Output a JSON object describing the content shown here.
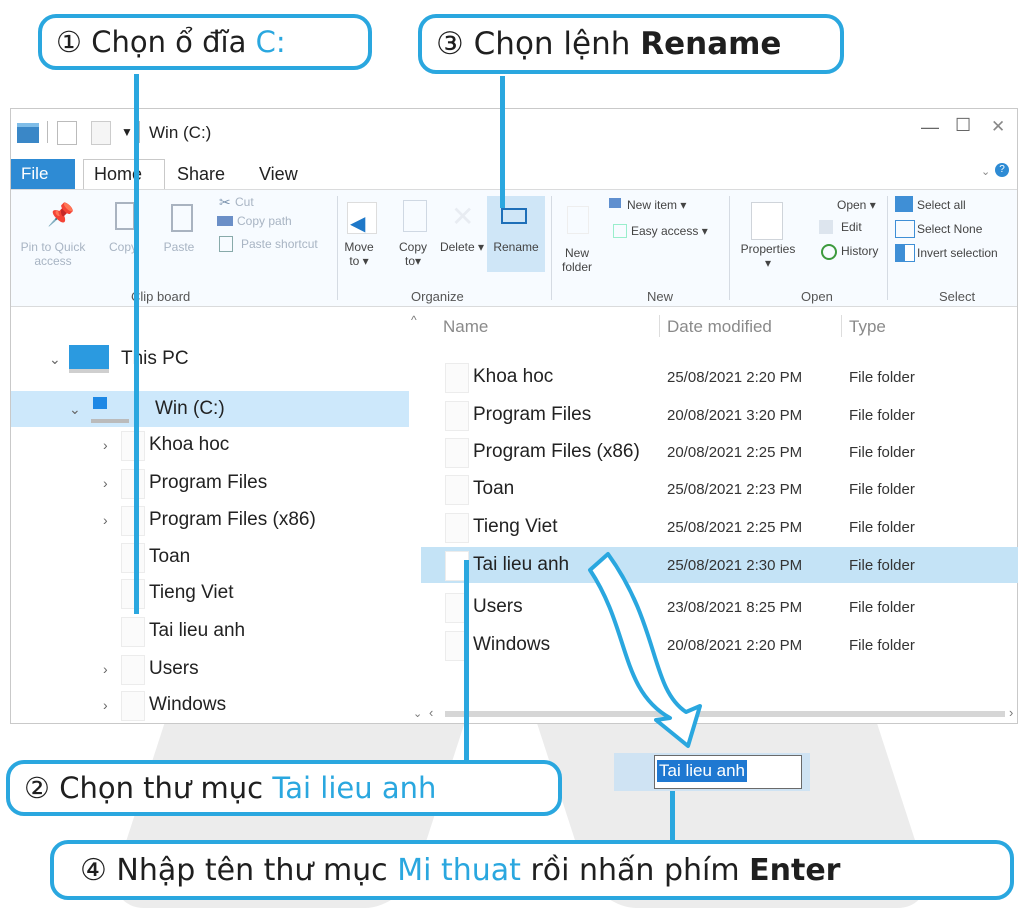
{
  "callouts": {
    "c1": {
      "prefix": "① Chọn ổ đĩa ",
      "highlight": "C:"
    },
    "c2": {
      "prefix": "② Chọn thư mục ",
      "highlight": "Tai lieu anh"
    },
    "c3": {
      "prefix": "③ Chọn lệnh ",
      "bold": "Rename"
    },
    "c4": {
      "prefix": "④ Nhập tên thư mục ",
      "highlight": "Mi thuat",
      "middle": " rồi nhấn phím ",
      "bold": "Enter"
    }
  },
  "window": {
    "title": "Win (C:)",
    "controls": {
      "minimize": "—",
      "maximize": "☐",
      "close": "✕"
    },
    "tabs": [
      "File",
      "Home",
      "Share",
      "View"
    ],
    "ribbon": {
      "clipboard": {
        "pin": "Pin to Quick access",
        "copy": "Copy",
        "paste": "Paste",
        "cut": "Cut",
        "copy_path": "Copy path",
        "paste_shortcut": "Paste shortcut",
        "group": "Clip board"
      },
      "organize": {
        "move_to": "Move to ▾",
        "copy_to": "Copy to▾",
        "delete": "Delete ▾",
        "rename": "Rename",
        "group": "Organize"
      },
      "new": {
        "new_folder": "New folder",
        "new_item": "New item ▾",
        "easy_access": "Easy access ▾",
        "group": "New"
      },
      "open": {
        "properties": "Properties ▾",
        "open": "Open ▾",
        "edit": "Edit",
        "history": "History",
        "group": "Open"
      },
      "select": {
        "select_all": "Select all",
        "select_none": "Select None",
        "invert": "Invert selection",
        "group": "Select"
      }
    },
    "nav": {
      "this_pc": "This PC",
      "drive": "Win (C:)",
      "items": [
        "Khoa hoc",
        "Program Files",
        "Program Files (x86)",
        "Toan",
        "Tieng Viet",
        "Tai lieu anh",
        "Users",
        "Windows"
      ]
    },
    "columns": {
      "name": "Name",
      "date": "Date modified",
      "type": "Type"
    },
    "files": [
      {
        "name": "Khoa hoc",
        "date": "25/08/2021 2:20 PM",
        "type": "File folder"
      },
      {
        "name": "Program Files",
        "date": "20/08/2021 3:20 PM",
        "type": "File folder"
      },
      {
        "name": "Program Files (x86)",
        "date": "20/08/2021 2:25 PM",
        "type": "File folder"
      },
      {
        "name": "Toan",
        "date": "25/08/2021 2:23 PM",
        "type": "File folder"
      },
      {
        "name": "Tieng Viet",
        "date": "25/08/2021 2:25 PM",
        "type": "File folder"
      },
      {
        "name": "Tai lieu anh",
        "date": "25/08/2021 2:30 PM",
        "type": "File folder"
      },
      {
        "name": "Users",
        "date": "23/08/2021 8:25 PM",
        "type": "File folder"
      },
      {
        "name": "Windows",
        "date": "20/08/2021 2:20 PM",
        "type": "File folder"
      }
    ]
  },
  "rename_box": {
    "value": "Tai lieu anh"
  },
  "colors": {
    "accent": "#2aa7df",
    "selection": "#c4e3f6",
    "rename_highlight": "#1f78d1"
  }
}
